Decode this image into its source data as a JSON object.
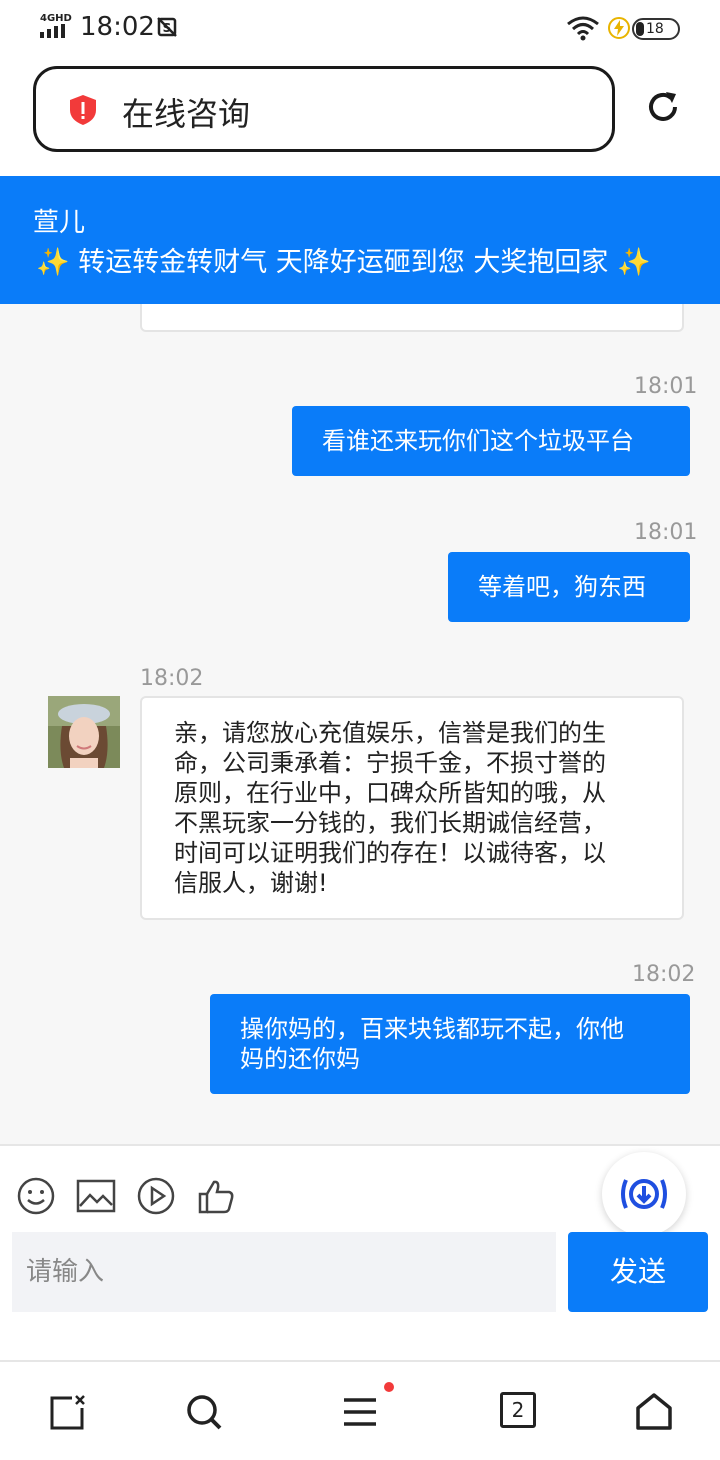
{
  "status_bar": {
    "network": "4GHD",
    "time": "18:02",
    "battery": "18"
  },
  "address_bar": {
    "title": "在线咨询"
  },
  "banner": {
    "agent_name": "萱儿",
    "message": "✨ 转运转金转财气 天降好运砸到您 大奖抱回家 ✨"
  },
  "messages": [
    {
      "side": "right",
      "time": "18:01",
      "lines": [
        "看谁还来玩你们这个垃圾平台"
      ]
    },
    {
      "side": "right",
      "time": "18:01",
      "lines": [
        "等着吧，狗东西"
      ]
    },
    {
      "side": "left",
      "time": "18:02",
      "lines": [
        "亲，请您放心充值娱乐，信誉是我们的生",
        "命，公司秉承着：宁损千金，不损寸誉的",
        "原则，在行业中，口碑众所皆知的哦，从",
        "不黑玩家一分钱的，我们长期诚信经营，",
        "时间可以证明我们的存在！以诚待客，以",
        "信服人，谢谢!"
      ]
    },
    {
      "side": "right",
      "time": "18:02",
      "lines": [
        "操你妈的，百来块钱都玩不起，你他",
        "妈的还你妈"
      ]
    }
  ],
  "input": {
    "placeholder": "请输入",
    "send_label": "发送"
  },
  "bottom_nav": {
    "tab_count": "2"
  },
  "colors": {
    "accent": "#0a7cf9",
    "badge": "#f23a3a"
  }
}
